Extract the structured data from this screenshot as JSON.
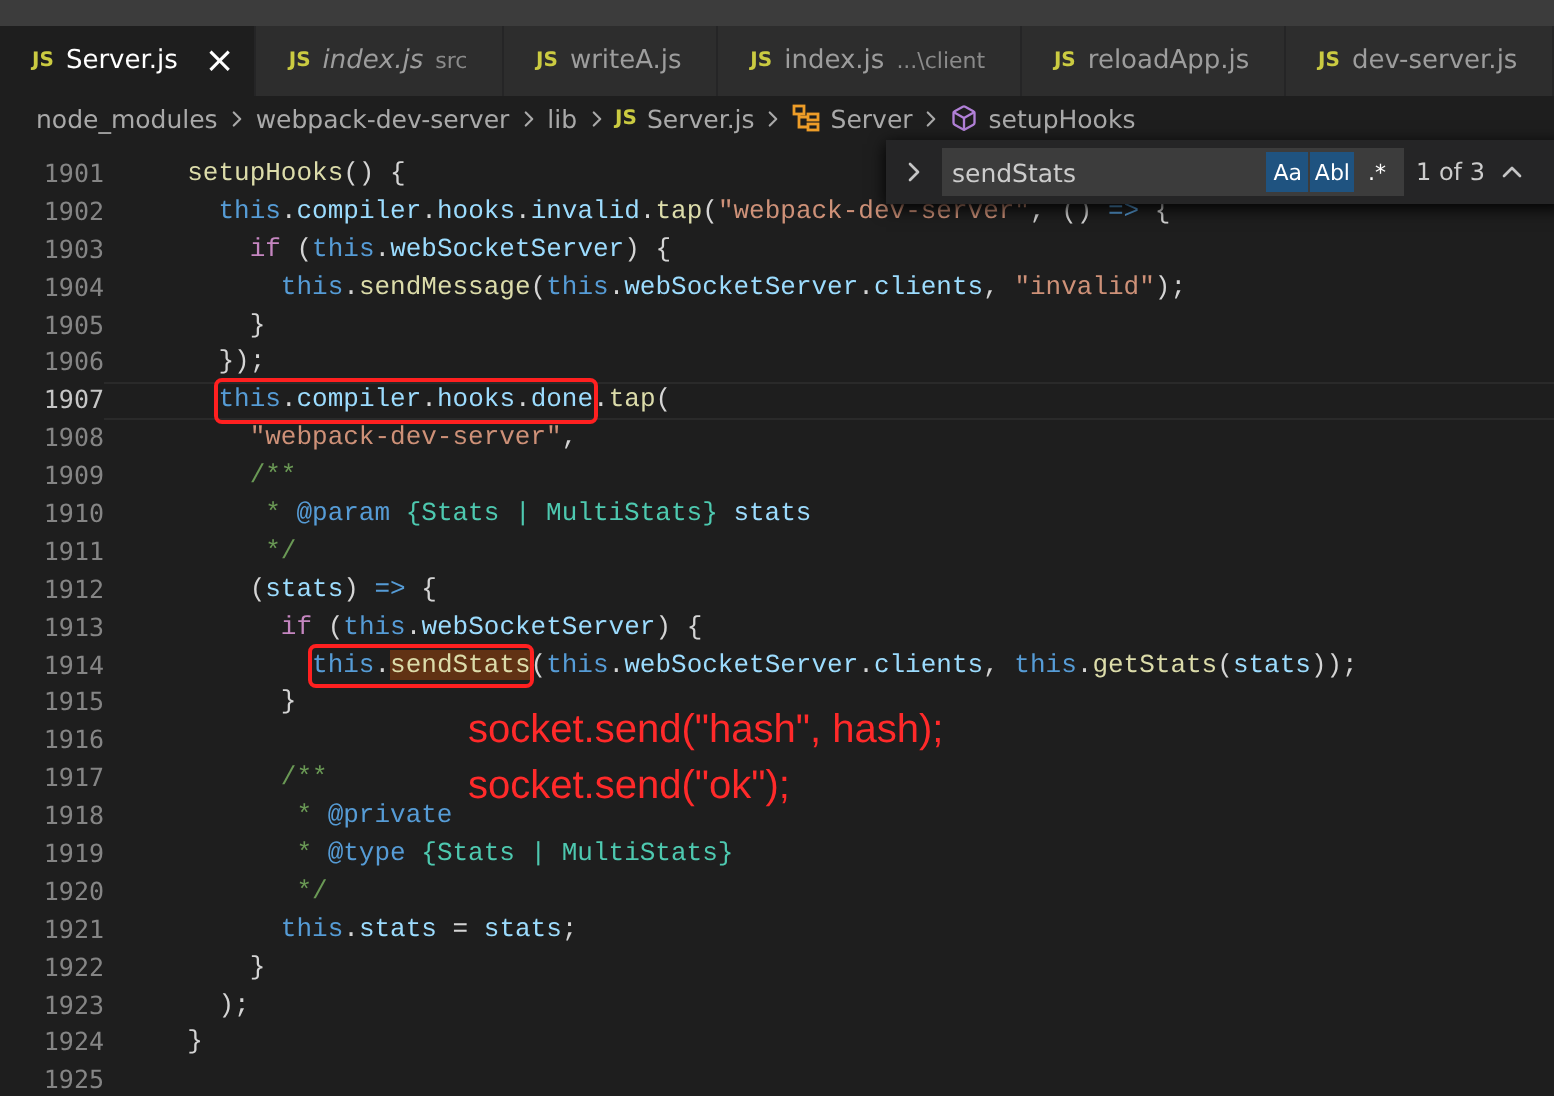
{
  "tabs": [
    {
      "badge": "JS",
      "label": "Server.js",
      "italic": false,
      "selected": true,
      "close": "×"
    },
    {
      "badge": "JS",
      "label": "index.js",
      "description": "src",
      "italic": true,
      "selected": false
    },
    {
      "badge": "JS",
      "label": "writeA.js",
      "italic": false,
      "selected": false
    },
    {
      "badge": "JS",
      "label": "index.js",
      "description": "...\\client",
      "italic": false,
      "selected": false
    },
    {
      "badge": "JS",
      "label": "reloadApp.js",
      "italic": false,
      "selected": false
    },
    {
      "badge": "JS",
      "label": "dev-server.js",
      "italic": false,
      "selected": false
    }
  ],
  "breadcrumb": [
    {
      "kind": "folder",
      "label": "node_modules"
    },
    {
      "kind": "folder",
      "label": "webpack-dev-server"
    },
    {
      "kind": "folder",
      "label": "lib"
    },
    {
      "kind": "file",
      "badge": "JS",
      "label": "Server.js"
    },
    {
      "kind": "class",
      "label": "Server"
    },
    {
      "kind": "method",
      "label": "setupHooks"
    }
  ],
  "find": {
    "value": "sendStats",
    "toggles": [
      {
        "label": "Aa",
        "selected": true
      },
      {
        "label": "Abl",
        "selected": true
      },
      {
        "label": ".*",
        "selected": false
      }
    ],
    "count": "1 of 3"
  },
  "code": [
    {
      "number": "1901",
      "current": false,
      "tokens": [
        {
          "kind": "func",
          "text": "  setupHooks"
        },
        {
          "kind": "plain",
          "text": "() {"
        }
      ]
    },
    {
      "number": "1902",
      "current": false,
      "tokens": [
        {
          "kind": "this",
          "text": "    this"
        },
        {
          "kind": "plain",
          "text": "."
        },
        {
          "kind": "prop",
          "text": "compiler"
        },
        {
          "kind": "plain",
          "text": "."
        },
        {
          "kind": "prop",
          "text": "hooks"
        },
        {
          "kind": "plain",
          "text": "."
        },
        {
          "kind": "prop",
          "text": "invalid"
        },
        {
          "kind": "plain",
          "text": "."
        },
        {
          "kind": "func",
          "text": "tap"
        },
        {
          "kind": "plain",
          "text": "("
        },
        {
          "kind": "string",
          "text": "\"webpack-dev-server\""
        },
        {
          "kind": "plain",
          "text": ", () "
        },
        {
          "kind": "this",
          "text": "=>"
        },
        {
          "kind": "plain",
          "text": " {"
        }
      ]
    },
    {
      "number": "1903",
      "current": false,
      "tokens": [
        {
          "kind": "control",
          "text": "      if"
        },
        {
          "kind": "plain",
          "text": " ("
        },
        {
          "kind": "this",
          "text": "this"
        },
        {
          "kind": "plain",
          "text": "."
        },
        {
          "kind": "prop",
          "text": "webSocketServer"
        },
        {
          "kind": "plain",
          "text": ") {"
        }
      ]
    },
    {
      "number": "1904",
      "current": false,
      "tokens": [
        {
          "kind": "this",
          "text": "        this"
        },
        {
          "kind": "plain",
          "text": "."
        },
        {
          "kind": "func",
          "text": "sendMessage"
        },
        {
          "kind": "plain",
          "text": "("
        },
        {
          "kind": "this",
          "text": "this"
        },
        {
          "kind": "plain",
          "text": "."
        },
        {
          "kind": "prop",
          "text": "webSocketServer"
        },
        {
          "kind": "plain",
          "text": "."
        },
        {
          "kind": "prop",
          "text": "clients"
        },
        {
          "kind": "plain",
          "text": ", "
        },
        {
          "kind": "string",
          "text": "\"invalid\""
        },
        {
          "kind": "plain",
          "text": ");"
        }
      ]
    },
    {
      "number": "1905",
      "current": false,
      "tokens": [
        {
          "kind": "plain",
          "text": "      }"
        }
      ]
    },
    {
      "number": "1906",
      "current": false,
      "tokens": [
        {
          "kind": "plain",
          "text": "    });"
        }
      ]
    },
    {
      "number": "1907",
      "current": true,
      "tokens": [
        {
          "kind": "box",
          "children": [
            {
              "kind": "this",
              "text": "    this"
            },
            {
              "kind": "plain",
              "text": "."
            },
            {
              "kind": "prop",
              "text": "compiler"
            },
            {
              "kind": "plain",
              "text": "."
            },
            {
              "kind": "prop",
              "text": "hooks"
            },
            {
              "kind": "plain",
              "text": "."
            },
            {
              "kind": "prop",
              "text": "done"
            }
          ]
        },
        {
          "kind": "plain",
          "text": "."
        },
        {
          "kind": "func",
          "text": "tap"
        },
        {
          "kind": "plain",
          "text": "("
        }
      ]
    },
    {
      "number": "1908",
      "current": false,
      "tokens": [
        {
          "kind": "string",
          "text": "      \"webpack-dev-server\""
        },
        {
          "kind": "plain",
          "text": ","
        }
      ]
    },
    {
      "number": "1909",
      "current": false,
      "tokens": [
        {
          "kind": "comment",
          "text": "      /**"
        }
      ]
    },
    {
      "number": "1910",
      "current": false,
      "tokens": [
        {
          "kind": "comment",
          "text": "       * "
        },
        {
          "kind": "tag",
          "text": "@param"
        },
        {
          "kind": "type",
          "text": " {Stats | MultiStats}"
        },
        {
          "kind": "prop",
          "text": " stats"
        }
      ]
    },
    {
      "number": "1911",
      "current": false,
      "tokens": [
        {
          "kind": "comment",
          "text": "       */"
        }
      ]
    },
    {
      "number": "1912",
      "current": false,
      "tokens": [
        {
          "kind": "plain",
          "text": "      ("
        },
        {
          "kind": "prop",
          "text": "stats"
        },
        {
          "kind": "plain",
          "text": ") "
        },
        {
          "kind": "this",
          "text": "=>"
        },
        {
          "kind": "plain",
          "text": " {"
        }
      ]
    },
    {
      "number": "1913",
      "current": false,
      "tokens": [
        {
          "kind": "control",
          "text": "        if"
        },
        {
          "kind": "plain",
          "text": " ("
        },
        {
          "kind": "this",
          "text": "this"
        },
        {
          "kind": "plain",
          "text": "."
        },
        {
          "kind": "prop",
          "text": "webSocketServer"
        },
        {
          "kind": "plain",
          "text": ") {"
        }
      ]
    },
    {
      "number": "1914",
      "current": false,
      "tokens": [
        {
          "kind": "box",
          "children": [
            {
              "kind": "this",
              "text": "          this"
            },
            {
              "kind": "plain",
              "text": "."
            },
            {
              "kind": "func",
              "text": "sendStats",
              "match": true
            }
          ]
        },
        {
          "kind": "plain",
          "text": "("
        },
        {
          "kind": "this",
          "text": "this"
        },
        {
          "kind": "plain",
          "text": "."
        },
        {
          "kind": "prop",
          "text": "webSocketServer"
        },
        {
          "kind": "plain",
          "text": "."
        },
        {
          "kind": "prop",
          "text": "clients"
        },
        {
          "kind": "plain",
          "text": ", "
        },
        {
          "kind": "this",
          "text": "this"
        },
        {
          "kind": "plain",
          "text": "."
        },
        {
          "kind": "func",
          "text": "getStats"
        },
        {
          "kind": "plain",
          "text": "("
        },
        {
          "kind": "prop",
          "text": "stats"
        },
        {
          "kind": "plain",
          "text": "));"
        }
      ]
    },
    {
      "number": "1915",
      "current": false,
      "tokens": [
        {
          "kind": "plain",
          "text": "        }"
        }
      ]
    },
    {
      "number": "1916",
      "current": false
    },
    {
      "number": "1917",
      "current": false,
      "tokens": [
        {
          "kind": "comment",
          "text": "        /**"
        }
      ]
    },
    {
      "number": "1918",
      "current": false,
      "tokens": [
        {
          "kind": "comment",
          "text": "         * "
        },
        {
          "kind": "tag",
          "text": "@private"
        }
      ]
    },
    {
      "number": "1919",
      "current": false,
      "tokens": [
        {
          "kind": "comment",
          "text": "         * "
        },
        {
          "kind": "tag",
          "text": "@type"
        },
        {
          "kind": "type",
          "text": " {Stats | MultiStats}"
        }
      ]
    },
    {
      "number": "1920",
      "current": false,
      "tokens": [
        {
          "kind": "comment",
          "text": "         */"
        }
      ]
    },
    {
      "number": "1921",
      "current": false,
      "tokens": [
        {
          "kind": "this",
          "text": "        this"
        },
        {
          "kind": "plain",
          "text": "."
        },
        {
          "kind": "prop",
          "text": "stats"
        },
        {
          "kind": "plain",
          "text": " = "
        },
        {
          "kind": "prop",
          "text": "stats"
        },
        {
          "kind": "plain",
          "text": ";"
        }
      ]
    },
    {
      "number": "1922",
      "current": false,
      "tokens": [
        {
          "kind": "plain",
          "text": "      }"
        }
      ]
    },
    {
      "number": "1923",
      "current": false,
      "tokens": [
        {
          "kind": "plain",
          "text": "    );"
        }
      ]
    },
    {
      "number": "1924",
      "current": false,
      "tokens": [
        {
          "kind": "plain",
          "text": "  }"
        }
      ]
    },
    {
      "number": "1925",
      "current": false
    }
  ],
  "annotation": [
    "socket.send(\"hash\", hash);",
    "socket.send(\"ok\");"
  ]
}
